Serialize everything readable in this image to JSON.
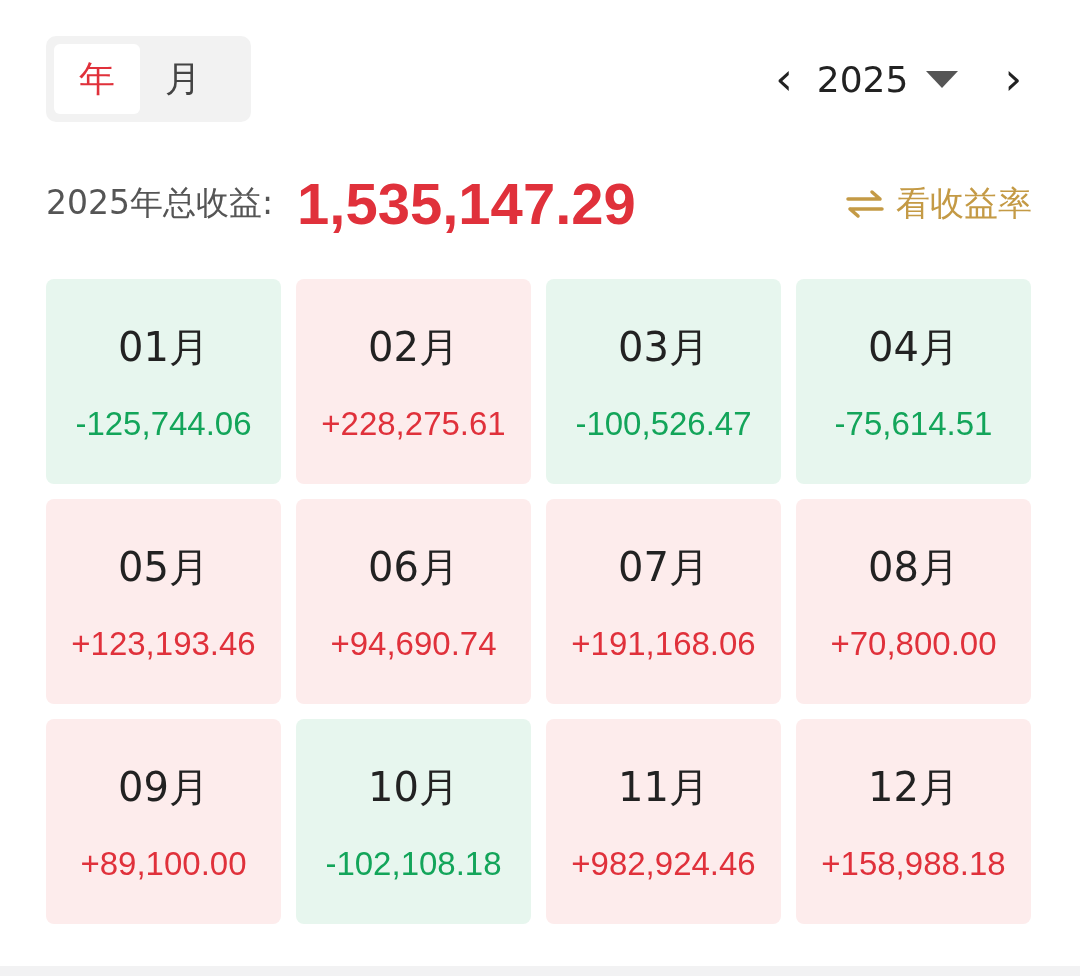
{
  "period_tabs": [
    {
      "label": "年",
      "selected": true
    },
    {
      "label": "月",
      "selected": false
    }
  ],
  "year_picker": {
    "prev": "‹",
    "year": "2025",
    "next": "›"
  },
  "summary": {
    "label": "2025年总收益:",
    "value": "1,535,147.29",
    "switch_link": "看收益率"
  },
  "months": [
    {
      "month": "01月",
      "value": "-125,744.06",
      "kind": "loss"
    },
    {
      "month": "02月",
      "value": "+228,275.61",
      "kind": "gain"
    },
    {
      "month": "03月",
      "value": "-100,526.47",
      "kind": "loss"
    },
    {
      "month": "04月",
      "value": "-75,614.51",
      "kind": "loss"
    },
    {
      "month": "05月",
      "value": "+123,193.46",
      "kind": "gain"
    },
    {
      "month": "06月",
      "value": "+94,690.74",
      "kind": "gain"
    },
    {
      "month": "07月",
      "value": "+191,168.06",
      "kind": "gain"
    },
    {
      "month": "08月",
      "value": "+70,800.00",
      "kind": "gain"
    },
    {
      "month": "09月",
      "value": "+89,100.00",
      "kind": "gain"
    },
    {
      "month": "10月",
      "value": "-102,108.18",
      "kind": "loss"
    },
    {
      "month": "11月",
      "value": "+982,924.46",
      "kind": "gain"
    },
    {
      "month": "12月",
      "value": "+158,988.18",
      "kind": "gain"
    }
  ]
}
